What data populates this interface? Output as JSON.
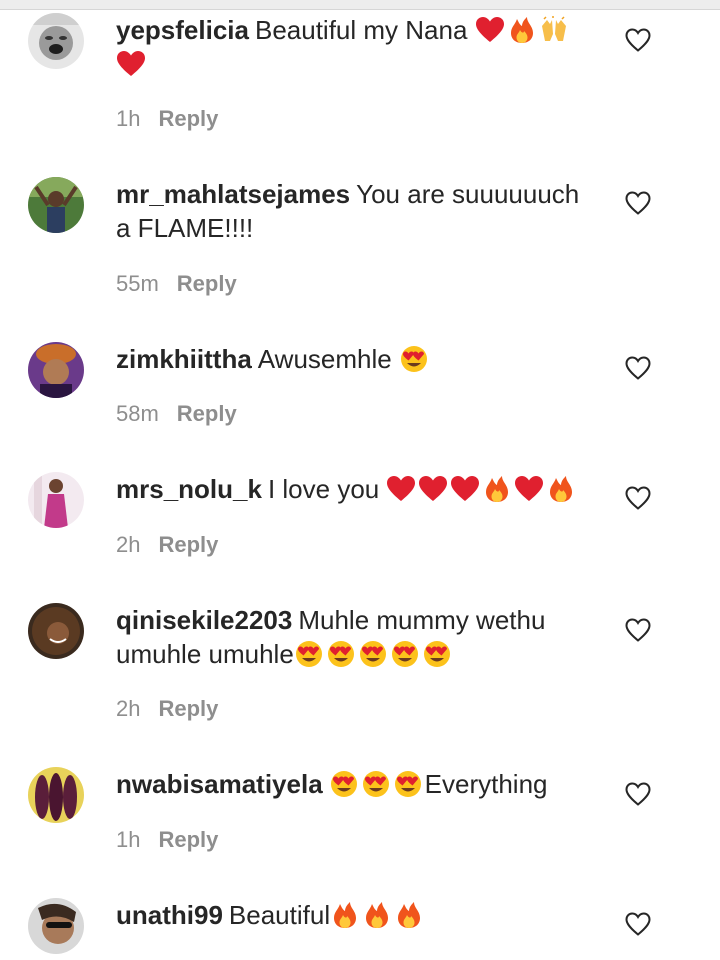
{
  "comments": [
    {
      "username": "yepsfelicia",
      "text": "Beautiful my Nana",
      "emojis": [
        "red-heart",
        "fire",
        "raising-hands",
        "red-heart"
      ],
      "time": "1h",
      "reply_label": "Reply"
    },
    {
      "username": "mr_mahlatsejames",
      "text": "You are suuuuuuch a FLAME!!!!",
      "emojis": [],
      "time": "55m",
      "reply_label": "Reply"
    },
    {
      "username": "zimkhiittha",
      "text": "Awusemhle",
      "emojis": [
        "heart-eyes"
      ],
      "time": "58m",
      "reply_label": "Reply"
    },
    {
      "username": "mrs_nolu_k",
      "text": "I love you",
      "emojis": [
        "red-heart",
        "red-heart",
        "red-heart",
        "fire",
        "red-heart",
        "fire"
      ],
      "time": "2h",
      "reply_label": "Reply"
    },
    {
      "username": "qinisekile2203",
      "text": "Muhle mummy wethu umuhle umuhle",
      "emojis": [
        "heart-eyes",
        "heart-eyes",
        "heart-eyes",
        "heart-eyes",
        "heart-eyes"
      ],
      "time": "2h",
      "reply_label": "Reply"
    },
    {
      "username": "nwabisamatiyela",
      "text": "Everything",
      "emojis": [
        "heart-eyes",
        "heart-eyes",
        "heart-eyes"
      ],
      "time": "1h",
      "reply_label": "Reply"
    },
    {
      "username": "unathi99",
      "text": "Beautiful",
      "emojis": [
        "fire",
        "fire",
        "fire"
      ],
      "time": "",
      "reply_label": ""
    }
  ],
  "icons": {
    "like": "heart-outline-icon"
  },
  "colors": {
    "text": "#262626",
    "meta": "#8e8e8e",
    "heart": "#e0202f",
    "fire": "#f0541c"
  }
}
